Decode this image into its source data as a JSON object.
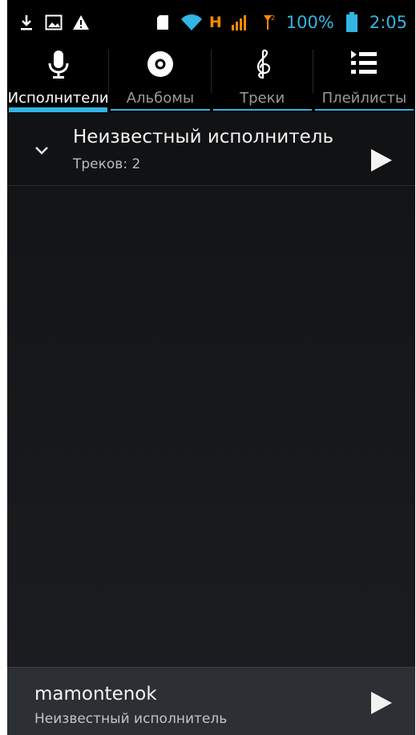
{
  "status_bar": {
    "network_type": "H",
    "battery_percent": "100%",
    "time": "2:05",
    "icons_left": [
      "download-icon",
      "image-icon",
      "warning-icon"
    ],
    "icons_right": [
      "sd-card-icon",
      "wifi-icon",
      "signal-icon",
      "roaming-icon",
      "battery-icon"
    ]
  },
  "tabs": [
    {
      "label": "Исполнители",
      "icon": "microphone-icon",
      "active": true
    },
    {
      "label": "Альбомы",
      "icon": "disc-icon",
      "active": false
    },
    {
      "label": "Треки",
      "icon": "treble-clef-icon",
      "active": false
    },
    {
      "label": "Плейлисты",
      "icon": "playlist-icon",
      "active": false
    }
  ],
  "artist_list": [
    {
      "name": "Неизвестный исполнитель",
      "count_label": "Треков: 2"
    }
  ],
  "mini_player": {
    "title": "mamontenok",
    "artist": "Неизвестный исполнитель"
  },
  "colors": {
    "accent": "#33b5e5",
    "network": "#ff8a00",
    "background": "#000000"
  }
}
